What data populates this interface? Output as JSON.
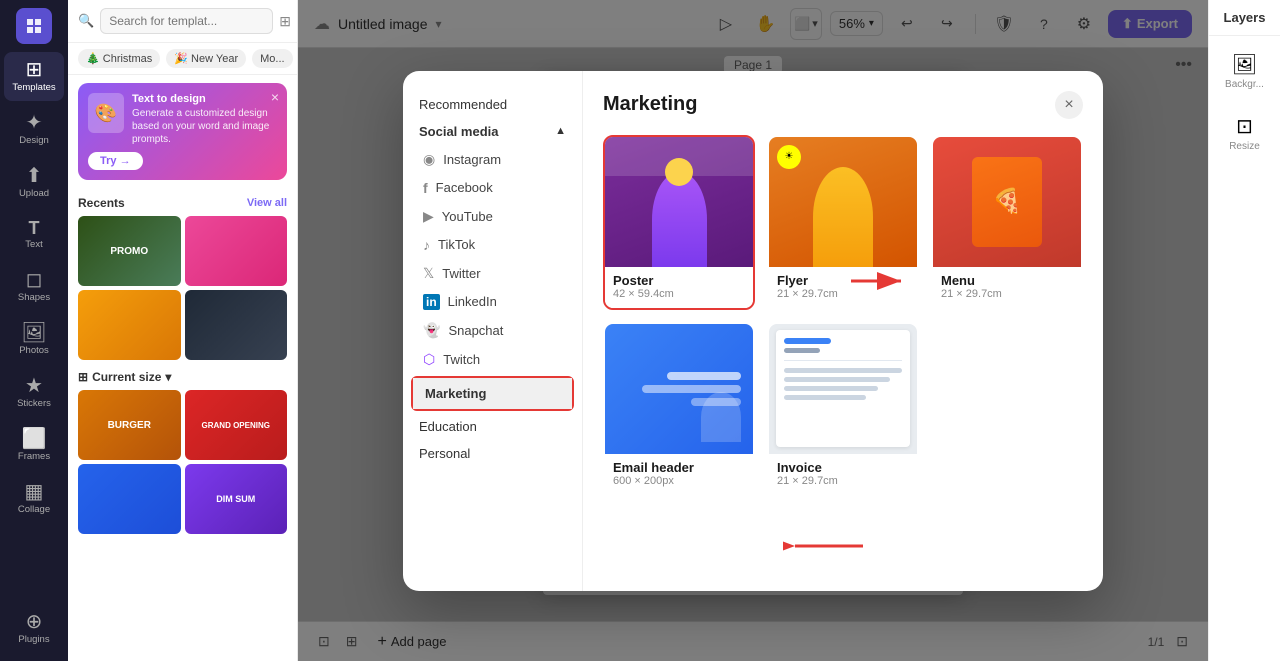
{
  "app": {
    "title": "Untitled image",
    "export_label": "Export",
    "zoom": "56%"
  },
  "sidebar": {
    "items": [
      {
        "id": "templates",
        "label": "Templates",
        "icon": "⊞"
      },
      {
        "id": "design",
        "label": "Design",
        "icon": "✦"
      },
      {
        "id": "upload",
        "label": "Upload",
        "icon": "⬆"
      },
      {
        "id": "text",
        "label": "Text",
        "icon": "T"
      },
      {
        "id": "shapes",
        "label": "Shapes",
        "icon": "◻"
      },
      {
        "id": "photos",
        "label": "Photos",
        "icon": "🖼"
      },
      {
        "id": "stickers",
        "label": "Stickers",
        "icon": "★"
      },
      {
        "id": "frames",
        "label": "Frames",
        "icon": "⬜"
      },
      {
        "id": "collage",
        "label": "Collage",
        "icon": "▦"
      },
      {
        "id": "plugins",
        "label": "Plugins",
        "icon": "⊕"
      }
    ]
  },
  "panel": {
    "search_placeholder": "Search for templat...",
    "tags": [
      {
        "label": "🎄 Christmas"
      },
      {
        "label": "🎉 New Year"
      },
      {
        "label": "Mo..."
      }
    ],
    "promo": {
      "title": "Text to design",
      "subtitle": "Generate a customized design based on your word and image prompts.",
      "try_label": "Try →"
    },
    "recents_label": "Recents",
    "view_all_label": "View all",
    "current_size_label": "Current size",
    "chevron": "▾"
  },
  "modal": {
    "title": "Marketing",
    "close_label": "×",
    "left": {
      "recommended_label": "Recommended",
      "social_media_label": "Social media",
      "social_media_expanded": true,
      "social_items": [
        {
          "id": "instagram",
          "label": "Instagram",
          "icon": "◉"
        },
        {
          "id": "facebook",
          "label": "Facebook",
          "icon": "f"
        },
        {
          "id": "youtube",
          "label": "YouTube",
          "icon": "▶"
        },
        {
          "id": "tiktok",
          "label": "TikTok",
          "icon": "♪"
        },
        {
          "id": "twitter",
          "label": "Twitter",
          "icon": "𝕏"
        },
        {
          "id": "linkedin",
          "label": "LinkedIn",
          "icon": "in"
        },
        {
          "id": "snapchat",
          "label": "Snapchat",
          "icon": "👻"
        },
        {
          "id": "twitch",
          "label": "Twitch",
          "icon": "📺"
        }
      ],
      "marketing_label": "Marketing",
      "education_label": "Education",
      "personal_label": "Personal"
    },
    "cards": [
      {
        "id": "poster",
        "label": "Poster",
        "size": "42 × 59.4cm",
        "selected": true,
        "thumb": "poster"
      },
      {
        "id": "flyer",
        "label": "Flyer",
        "size": "21 × 29.7cm",
        "selected": false,
        "thumb": "flyer"
      },
      {
        "id": "menu",
        "label": "Menu",
        "size": "21 × 29.7cm",
        "selected": false,
        "thumb": "menu"
      },
      {
        "id": "email_header",
        "label": "Email header",
        "size": "600 × 200px",
        "selected": false,
        "thumb": "email"
      },
      {
        "id": "invoice",
        "label": "Invoice",
        "size": "21 × 29.7cm",
        "selected": false,
        "thumb": "invoice"
      }
    ]
  },
  "canvas": {
    "page_label": "Page 1"
  },
  "bottom_bar": {
    "add_page_label": "Add page",
    "page_count": "1/1"
  },
  "right_panel": {
    "items": [
      {
        "id": "background",
        "label": "Backgr...",
        "icon": "🖼"
      },
      {
        "id": "resize",
        "label": "Resize",
        "icon": "⊡"
      }
    ]
  },
  "layers_panel": {
    "title": "Layers"
  }
}
